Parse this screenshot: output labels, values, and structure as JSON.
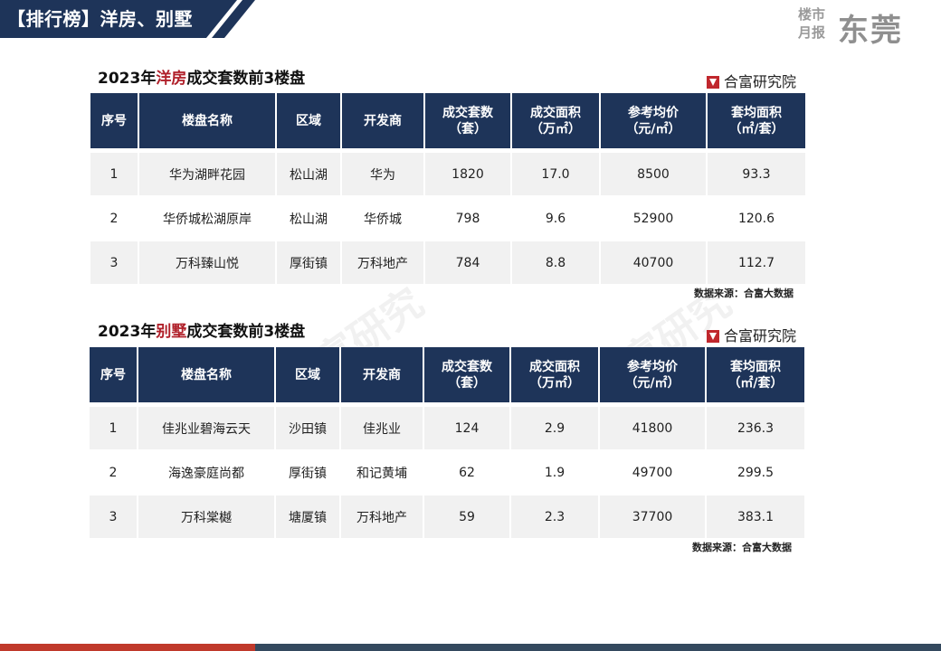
{
  "banner": {
    "title": "【排行榜】洋房、别墅"
  },
  "brand": {
    "small_line1": "楼市",
    "small_line2": "月报",
    "big": "东莞"
  },
  "colors": {
    "header_bg": "#1e3459",
    "highlight": "#b0202a",
    "footer_left": "#c0392b",
    "footer_right": "#34495e"
  },
  "section1": {
    "title_pre": "2023年",
    "title_hl": "洋房",
    "title_post": "成交套数前3楼盘",
    "source_logo": "合富研究院",
    "note": "数据来源：合富大数据",
    "headers": [
      {
        "l1": "序号",
        "l2": ""
      },
      {
        "l1": "楼盘名称",
        "l2": ""
      },
      {
        "l1": "区域",
        "l2": ""
      },
      {
        "l1": "开发商",
        "l2": ""
      },
      {
        "l1": "成交套数",
        "l2": "（套）"
      },
      {
        "l1": "成交面积",
        "l2": "（万㎡）"
      },
      {
        "l1": "参考均价",
        "l2": "（元/㎡）"
      },
      {
        "l1": "套均面积",
        "l2": "（㎡/套）"
      }
    ],
    "rows": [
      [
        "1",
        "华为湖畔花园",
        "松山湖",
        "华为",
        "1820",
        "17.0",
        "8500",
        "93.3"
      ],
      [
        "2",
        "华侨城松湖原岸",
        "松山湖",
        "华侨城",
        "798",
        "9.6",
        "52900",
        "120.6"
      ],
      [
        "3",
        "万科臻山悦",
        "厚街镇",
        "万科地产",
        "784",
        "8.8",
        "40700",
        "112.7"
      ]
    ]
  },
  "section2": {
    "title_pre": "2023年",
    "title_hl": "别墅",
    "title_post": "成交套数前3楼盘",
    "source_logo": "合富研究院",
    "note": "数据来源：合富大数据",
    "headers": [
      {
        "l1": "序号",
        "l2": ""
      },
      {
        "l1": "楼盘名称",
        "l2": ""
      },
      {
        "l1": "区域",
        "l2": ""
      },
      {
        "l1": "开发商",
        "l2": ""
      },
      {
        "l1": "成交套数",
        "l2": "（套）"
      },
      {
        "l1": "成交面积",
        "l2": "（万㎡）"
      },
      {
        "l1": "参考均价",
        "l2": "（元/㎡）"
      },
      {
        "l1": "套均面积",
        "l2": "（㎡/套）"
      }
    ],
    "rows": [
      [
        "1",
        "佳兆业碧海云天",
        "沙田镇",
        "佳兆业",
        "124",
        "2.9",
        "41800",
        "236.3"
      ],
      [
        "2",
        "海逸豪庭尚都",
        "厚街镇",
        "和记黄埔",
        "62",
        "1.9",
        "49700",
        "299.5"
      ],
      [
        "3",
        "万科棠樾",
        "塘厦镇",
        "万科地产",
        "59",
        "2.3",
        "37700",
        "383.1"
      ]
    ]
  },
  "watermark": "合富研究"
}
